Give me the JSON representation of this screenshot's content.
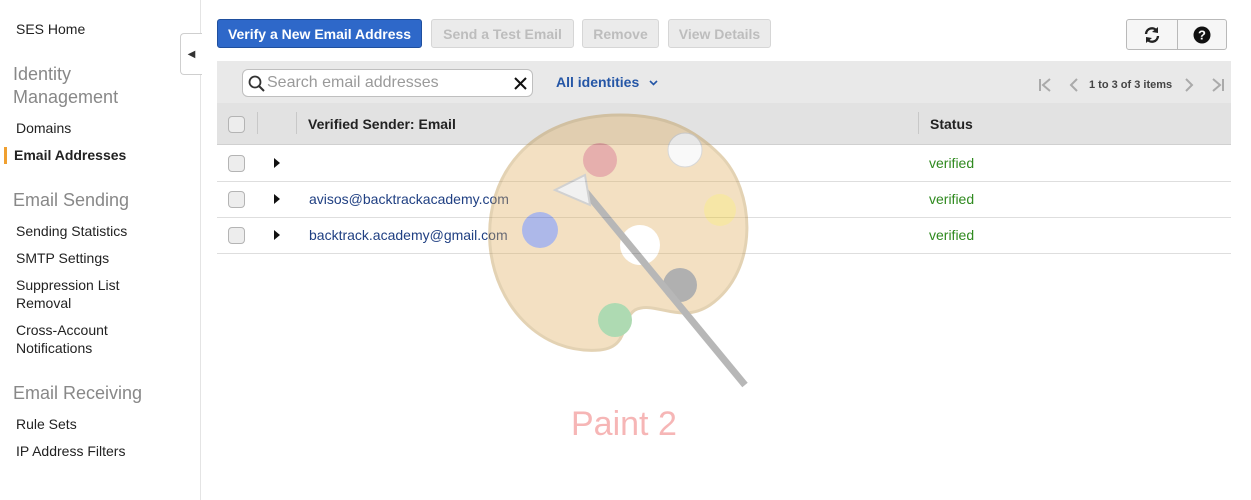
{
  "sidebar": {
    "home": "SES Home",
    "sections": [
      {
        "title": "Identity Management",
        "items": [
          "Domains",
          "Email Addresses"
        ]
      },
      {
        "title": "Email Sending",
        "items": [
          "Sending Statistics",
          "SMTP Settings",
          "Suppression List Removal",
          "Cross-Account Notifications"
        ]
      },
      {
        "title": "Email Receiving",
        "items": [
          "Rule Sets",
          "IP Address Filters"
        ]
      }
    ],
    "active_item": "Email Addresses",
    "active_color": "#f0a030"
  },
  "toolbar": {
    "verify_label": "Verify a New Email Address",
    "send_test_label": "Send a Test Email",
    "remove_label": "Remove",
    "view_details_label": "View Details",
    "refresh_icon": "refresh-icon",
    "help_icon": "help-icon"
  },
  "filter": {
    "search_placeholder": "Search email addresses",
    "search_value": "",
    "identities_label": "All identities",
    "pager_text": "1 to 3 of 3 items"
  },
  "table": {
    "columns": [
      "Verified Sender: Email",
      "Status"
    ],
    "rows": [
      {
        "email": "",
        "status": "verified"
      },
      {
        "email": "avisos@backtrackacademy.com",
        "status": "verified"
      },
      {
        "email": "backtrack.academy@gmail.com",
        "status": "verified"
      }
    ]
  },
  "watermark": {
    "label": "Paint 2"
  },
  "colors": {
    "primary": "#2e68c9",
    "status_ok": "#2f8a1f",
    "link": "#1f3f82"
  }
}
